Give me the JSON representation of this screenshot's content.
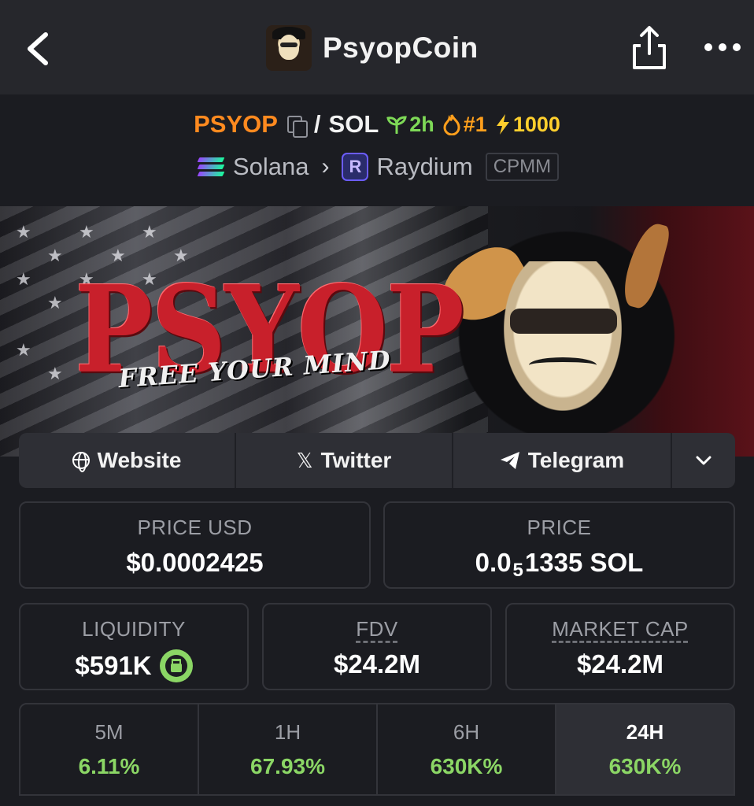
{
  "header": {
    "title": "PsyopCoin",
    "back_icon": "chevron-left-icon",
    "share_icon": "share-icon",
    "more_icon": "more-dots-icon"
  },
  "pair": {
    "base": "PSYOP",
    "separator": "/",
    "quote": "SOL",
    "age": "2h",
    "rank": "#1",
    "boost": "1000"
  },
  "chain": {
    "network": "Solana",
    "dex": "Raydium",
    "pool_type": "CPMM"
  },
  "banner": {
    "headline": "PSYOP",
    "tagline": "FREE YOUR MIND"
  },
  "socials": {
    "website": "Website",
    "twitter": "Twitter",
    "telegram": "Telegram"
  },
  "stats": {
    "price_usd_label": "PRICE USD",
    "price_usd": "$0.0002425",
    "price_label": "PRICE",
    "price_sol_prefix": "0.0",
    "price_sol_zeros": "5",
    "price_sol_rest": "1335 SOL",
    "liquidity_label": "LIQUIDITY",
    "liquidity": "$591K",
    "fdv_label": "FDV",
    "fdv": "$24.2M",
    "mcap_label": "MARKET CAP",
    "mcap": "$24.2M"
  },
  "timeframes": [
    {
      "label": "5M",
      "change": "6.11%"
    },
    {
      "label": "1H",
      "change": "67.93%"
    },
    {
      "label": "6H",
      "change": "630K%"
    },
    {
      "label": "24H",
      "change": "630K%"
    }
  ],
  "colors": {
    "base_token": "#ff8a1f",
    "positive": "#8bd665",
    "background": "#1b1c21",
    "topbar": "#26272c"
  }
}
